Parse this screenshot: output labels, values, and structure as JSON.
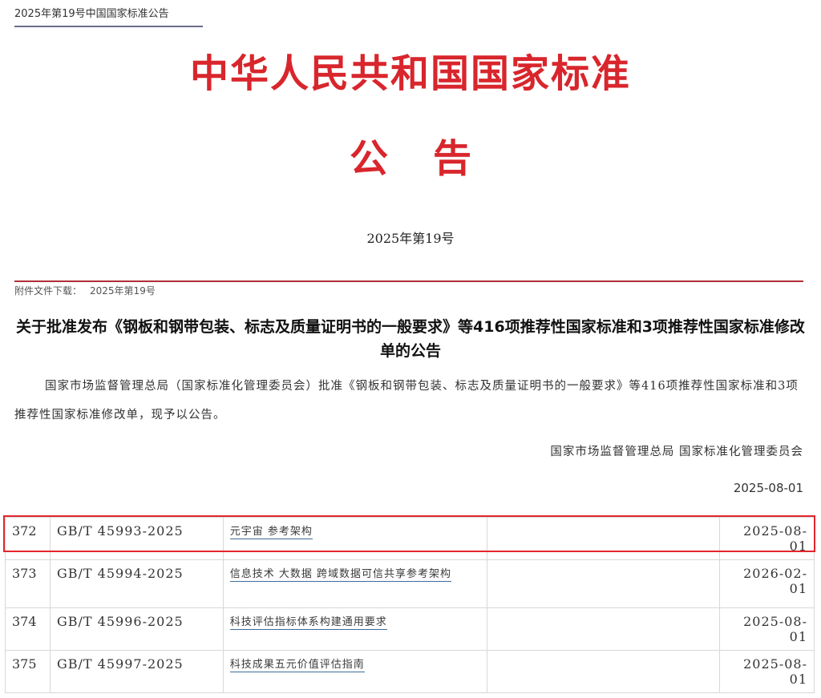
{
  "header": {
    "page_label": "2025年第19号中国国家标准公告",
    "masthead": "中华人民共和国国家标准",
    "announcement": "公告",
    "issue_number": "2025年第19号"
  },
  "attachment": {
    "label": "附件文件下载：",
    "link": "2025年第19号"
  },
  "notice": {
    "title": "关于批准发布《钢板和钢带包装、标志及质量证明书的一般要求》等416项推荐性国家标准和3项推荐性国家标准修改单的公告",
    "body": "国家市场监督管理总局（国家标准化管理委员会）批准《钢板和钢带包装、标志及质量证明书的一般要求》等416项推荐性国家标准和3项推荐性国家标准修改单，现予以公告。",
    "issuer": "国家市场监督管理总局 国家标准化管理委员会",
    "date": "2025-08-01"
  },
  "standards": [
    {
      "no": "372",
      "code": "GB/T 45993-2025",
      "name": "元宇宙 参考架构",
      "date": "2025-08-01"
    },
    {
      "no": "373",
      "code": "GB/T 45994-2025",
      "name": "信息技术 大数据 跨域数据可信共享参考架构",
      "date": "2026-02-01"
    },
    {
      "no": "374",
      "code": "GB/T 45996-2025",
      "name": "科技评估指标体系构建通用要求",
      "date": "2025-08-01"
    },
    {
      "no": "375",
      "code": "GB/T 45997-2025",
      "name": "科技成果五元价值评估指南",
      "date": "2025-08-01"
    }
  ],
  "colors": {
    "masthead_red": "#d8262c",
    "highlight_red": "#e3262d",
    "link_underline": "#3d6d99"
  }
}
